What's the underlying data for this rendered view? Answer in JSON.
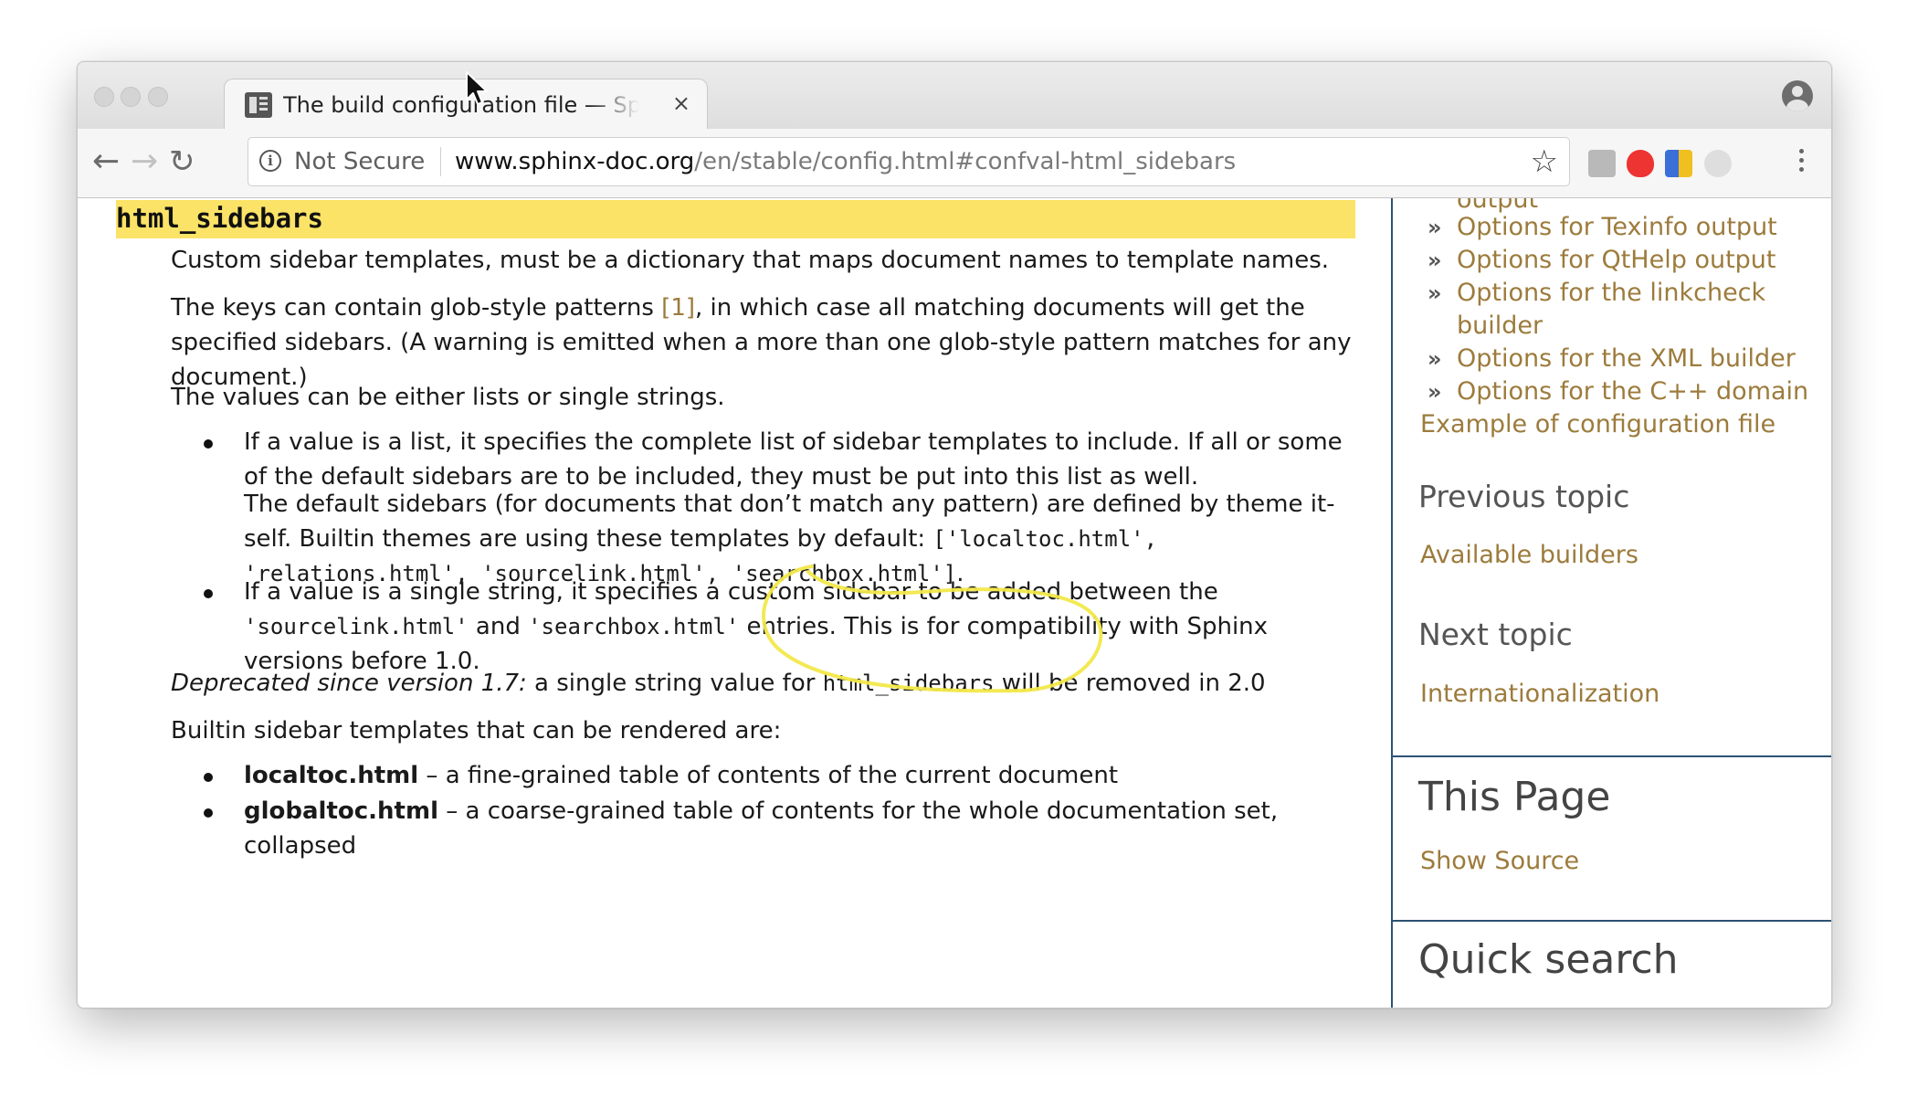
{
  "browser": {
    "tab_title": "The build configuration file — Sphinx",
    "tab_close": "×",
    "security_label": "Not Secure",
    "url_host": "www.sphinx-doc.org",
    "url_path": "/en/stable/config.html#confval-html_sidebars",
    "bookmark_icon": "☆"
  },
  "content": {
    "heading": "html_sidebars",
    "p1": "Custom sidebar templates, must be a dictionary that maps document names to template names.",
    "p2_line1_a": "The keys can contain glob-style patterns ",
    "p2_ref": "[1]",
    "p2_line1_b": ", in which case all matching documents will get the",
    "p2_line2": "specified sidebars. (A warning is emitted when a more than one glob-style pattern matches for any",
    "p2_line3": "document.)",
    "p3": "The values can be either lists or single strings.",
    "li1_line1": "If a value is a list, it specifies the complete list of sidebar templates to include. If all or some",
    "li1_line2": "of the default sidebars are to be included, they must be put into this list as well.",
    "li1b_line1": "The default sidebars (for documents that don’t match any pattern) are defined by theme it-",
    "li1b_line2": "self. Builtin themes are using these templates by default: ",
    "li1b_code1": "['localtoc.html',",
    "li1b_code2": "'relations.html', 'sourcelink.html', 'searchbox.html']",
    "li1b_end": ".",
    "li2_line1": "If a value is a single string, it specifies a custom sidebar to be added between the",
    "li2_code1": "'sourcelink.html'",
    "li2_and": " and ",
    "li2_code2": "'searchbox.html'",
    "li2_tail": " entries. This is for compatibility with Sphinx",
    "li2_line3": "versions before 1.0.",
    "deprecated_em": "Deprecated since version 1.7:",
    "deprecated_a": " a single string value for ",
    "deprecated_code": "html_sidebars",
    "deprecated_b": " will be removed in 2.0",
    "p4": "Builtin sidebar templates that can be rendered are:",
    "t1_name": "localtoc.html",
    "t1_desc": " – a fine-grained table of contents of the current document",
    "t2_name": "globaltoc.html",
    "t2_desc": " – a coarse-grained table of contents for the whole documentation set,",
    "t2_desc2": "collapsed"
  },
  "sidebar": {
    "cut_item": "output",
    "items": [
      "Options for Texinfo output",
      "Options for QtHelp output",
      "Options for the linkcheck",
      "builder",
      "Options for the XML builder",
      "Options for the C++ domain"
    ],
    "example_link": "Example of configuration file",
    "prev_heading": "Previous topic",
    "prev_link": "Available builders",
    "next_heading": "Next topic",
    "next_link": "Internationalization",
    "this_page": "This Page",
    "show_source": "Show Source",
    "quick_search": "Quick search"
  },
  "colors": {
    "link": "#9c7b3c",
    "highlight": "#fbe367",
    "sidebar_rule": "#2c5274",
    "annotation": "#f2e84a"
  }
}
